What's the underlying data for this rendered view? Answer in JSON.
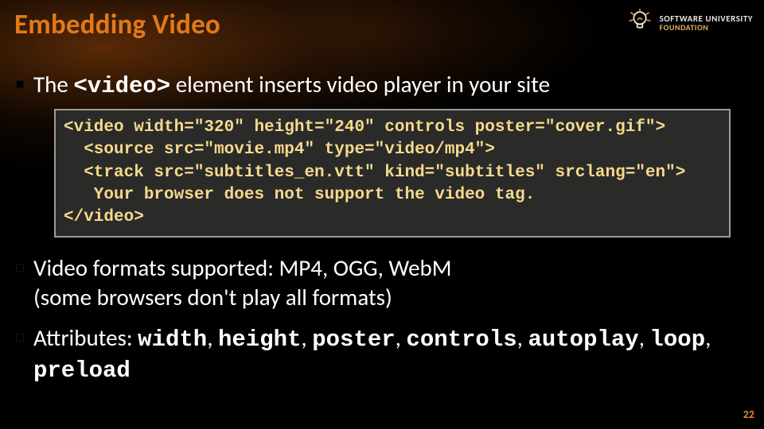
{
  "title": "Embedding Video",
  "logo": {
    "line1": "SOFTWARE UNIVERSITY",
    "line2": "FOUNDATION"
  },
  "bullet1": {
    "pre": "The ",
    "mono": "<video>",
    "post": " element inserts video player in your site"
  },
  "code": "<video width=\"320\" height=\"240\" controls poster=\"cover.gif\">\n  <source src=\"movie.mp4\" type=\"video/mp4\">\n  <track src=\"subtitles_en.vtt\" kind=\"subtitles\" srclang=\"en\">\n   Your browser does not support the video tag.\n</video>",
  "bullet2": {
    "line1": "Video formats supported: MP4, OGG, WebM",
    "line2": "(some browsers don't play all formats)"
  },
  "bullet3": {
    "label": "Attributes: ",
    "attrs": [
      "width",
      "height",
      "poster",
      "controls",
      "autoplay",
      "loop",
      "preload"
    ]
  },
  "page_number": "22"
}
